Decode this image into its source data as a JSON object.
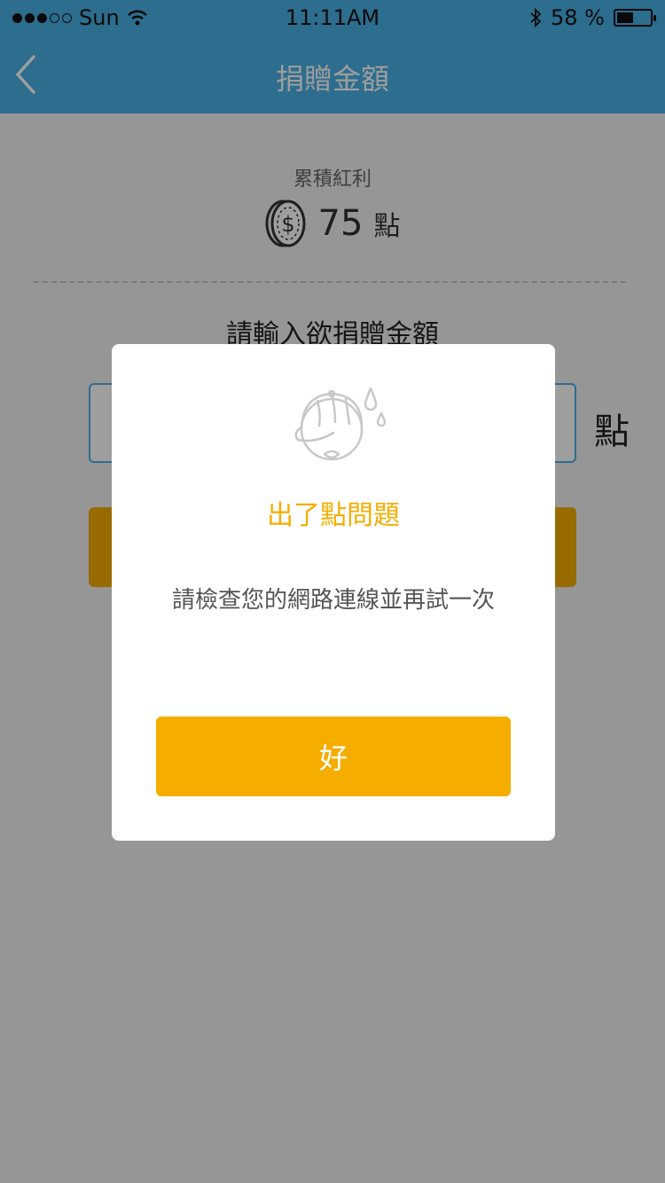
{
  "status_bar": {
    "carrier": "Sun",
    "time": "11:11AM",
    "battery": "58 %",
    "battery_level": 0.58,
    "icons": [
      "signal-icon",
      "wifi-icon",
      "bluetooth-icon",
      "battery-icon"
    ]
  },
  "nav": {
    "title": "捐贈金額",
    "back_icon": "chevron-left-icon"
  },
  "bonus": {
    "label": "累積紅利",
    "value": "75",
    "unit": "點",
    "icon": "coin-icon"
  },
  "donation": {
    "prompt": "請輸入欲捐贈金額",
    "input_value": "",
    "unit": "點"
  },
  "dialog": {
    "title": "出了點問題",
    "message": "請檢查您的網路連線並再試一次",
    "ok_label": "好",
    "illustration": "sweating-face-icon"
  },
  "colors": {
    "brand_blue": "#4ab0e6",
    "accent_orange": "#f5ad00"
  }
}
